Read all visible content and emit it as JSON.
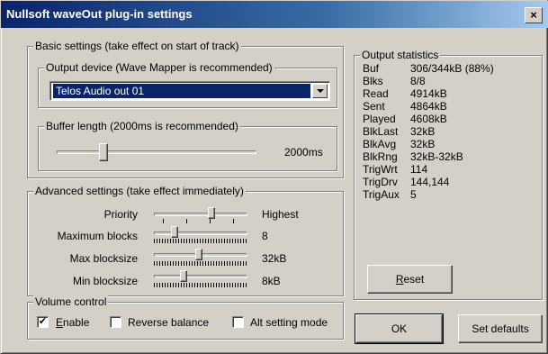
{
  "window": {
    "title": "Nullsoft waveOut plug-in settings",
    "close_glyph": "×"
  },
  "basic": {
    "group_label": "Basic settings (take effect on start of track)",
    "device_group_label": "Output device (Wave Mapper is recommended)",
    "device_selected": "Telos Audio out 01",
    "buffer_group_label": "Buffer length (2000ms is recommended)",
    "buffer_value": "2000ms",
    "buffer_level": 0.22
  },
  "advanced": {
    "group_label": "Advanced settings (take effect immediately)",
    "rows": [
      {
        "label": "Priority",
        "value": "Highest",
        "level": 0.63
      },
      {
        "label": "Maximum blocks",
        "value": "8",
        "level": 0.2
      },
      {
        "label": "Max blocksize",
        "value": "32kB",
        "level": 0.48
      },
      {
        "label": "Min blocksize",
        "value": "8kB",
        "level": 0.3
      }
    ]
  },
  "volume": {
    "group_label": "Volume control",
    "enable": {
      "mnemonic": "E",
      "rest": "nable",
      "checked": true,
      "mark": "✔"
    },
    "reverse_balance": {
      "label": "Reverse balance",
      "checked": false
    },
    "alt_setting_mode": {
      "label": "Alt setting mode",
      "checked": false
    }
  },
  "stats": {
    "group_label": "Output statistics",
    "rows": [
      {
        "key": "Buf",
        "value": "306/344kB (88%)"
      },
      {
        "key": "Blks",
        "value": "8/8"
      },
      {
        "key": "Read",
        "value": "4914kB"
      },
      {
        "key": "Sent",
        "value": "4864kB"
      },
      {
        "key": "Played",
        "value": "4608kB"
      },
      {
        "key": "BlkLast",
        "value": "32kB"
      },
      {
        "key": "BlkAvg",
        "value": "32kB"
      },
      {
        "key": "BlkRng",
        "value": "32kB-32kB"
      },
      {
        "key": "TrigWrt",
        "value": "114"
      },
      {
        "key": "TrigDrv",
        "value": "144,144"
      },
      {
        "key": "TrigAux",
        "value": "5"
      }
    ],
    "reset": {
      "mnemonic": "R",
      "rest": "eset"
    }
  },
  "buttons": {
    "ok": "OK",
    "set_defaults": "Set defaults"
  }
}
